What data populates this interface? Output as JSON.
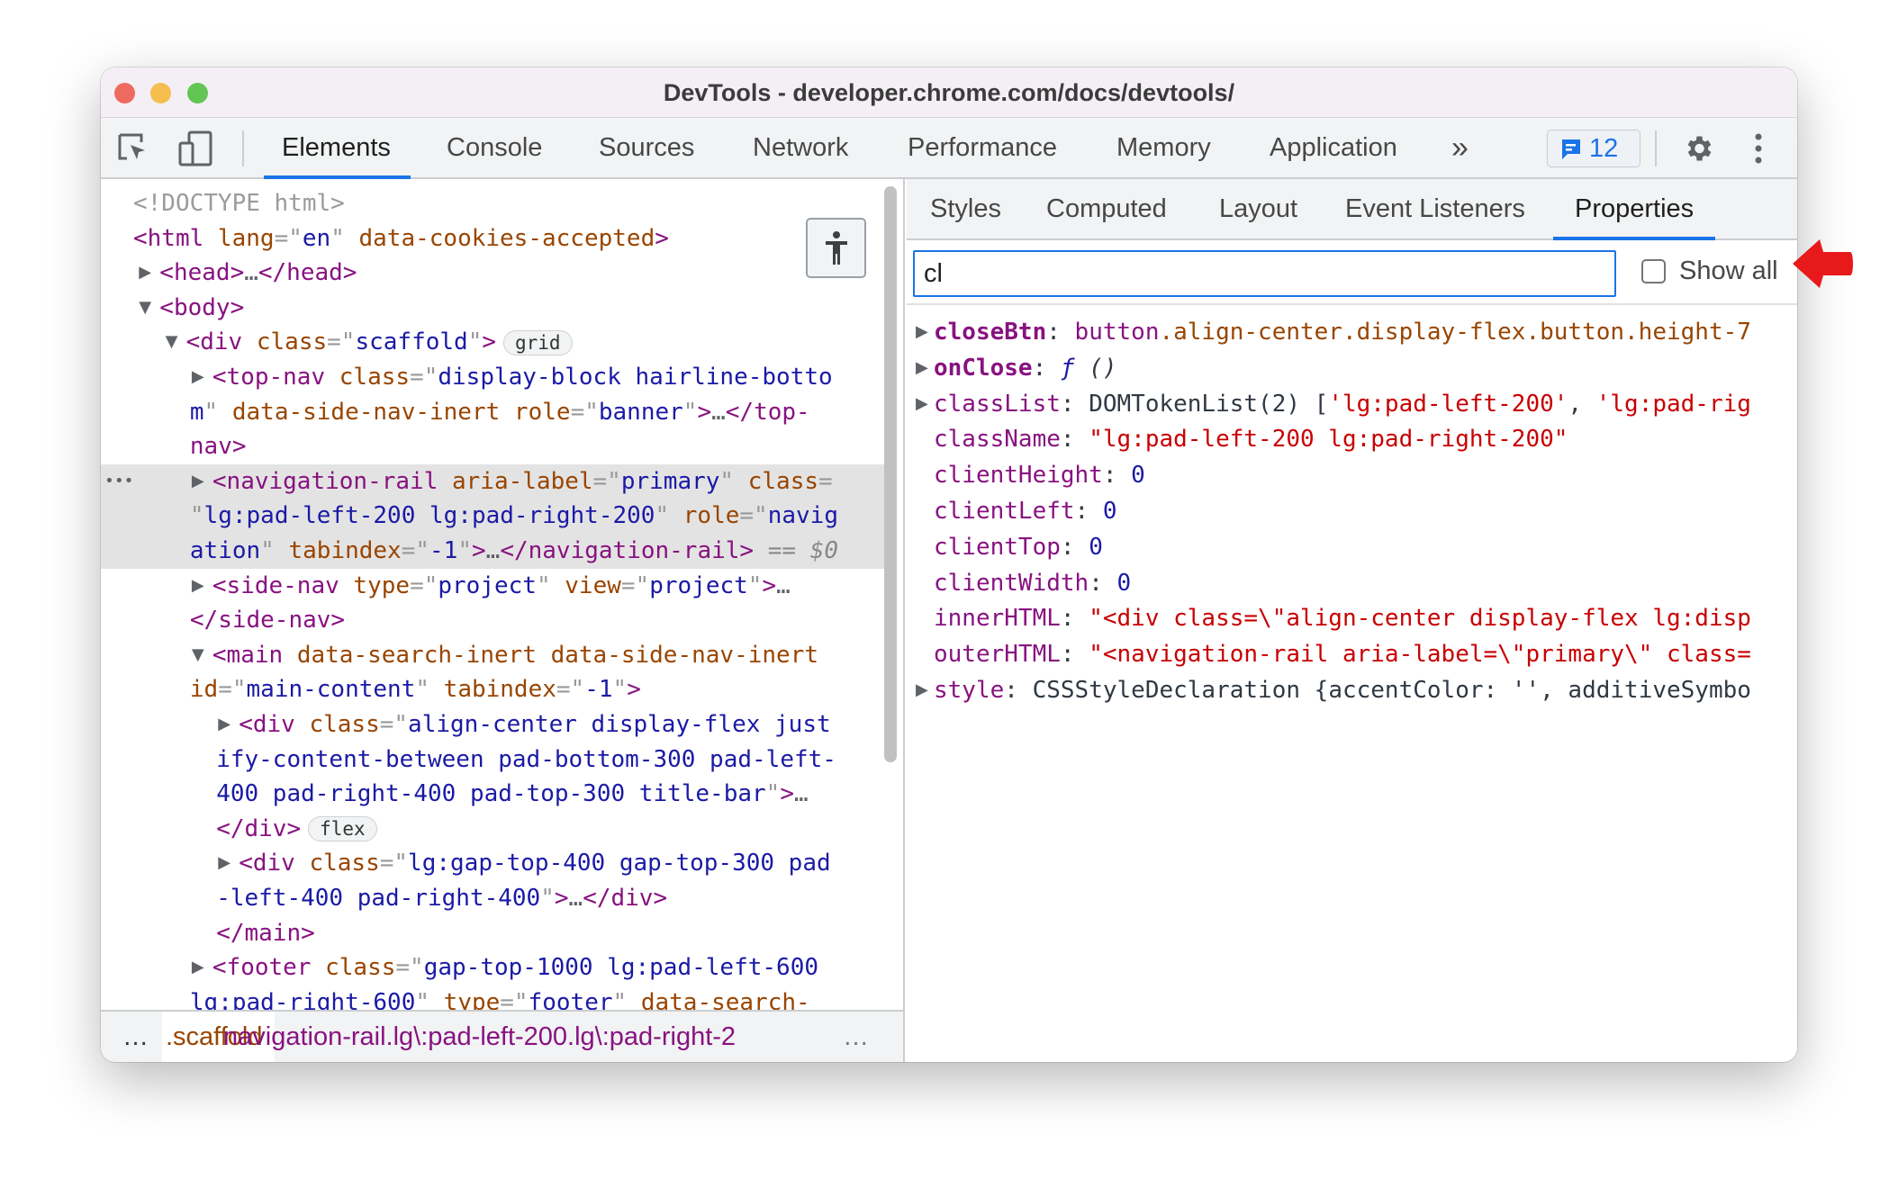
{
  "window": {
    "title": "DevTools - developer.chrome.com/docs/devtools/"
  },
  "colors": {
    "accent": "#1a73e8",
    "close": "#ee6a5f",
    "minimize": "#f5be4f",
    "zoom": "#62c554",
    "arrow": "#e8191a"
  },
  "toolbar": {
    "tabs": [
      "Elements",
      "Console",
      "Sources",
      "Network",
      "Performance",
      "Memory",
      "Application"
    ],
    "active_tab": "Elements",
    "more": "»",
    "issues_count": "12"
  },
  "elements": {
    "lines": [
      {
        "depth": 0,
        "segs": [
          [
            "c",
            "<!DOCTYPE html>"
          ]
        ]
      },
      {
        "depth": 0,
        "segs": [
          [
            "t",
            "<html"
          ],
          [
            "a",
            " lang"
          ],
          [
            "p",
            "=\""
          ],
          [
            "v",
            "en"
          ],
          [
            "p",
            "\""
          ],
          [
            "a",
            " data-cookies-accepted"
          ],
          [
            "t",
            ">"
          ]
        ]
      },
      {
        "depth": 1,
        "toggle": "right",
        "segs": [
          [
            "t",
            "<head>"
          ],
          [
            "g",
            "…"
          ],
          [
            "t",
            "</head>"
          ]
        ]
      },
      {
        "depth": 1,
        "toggle": "down",
        "segs": [
          [
            "t",
            "<body>"
          ]
        ]
      },
      {
        "depth": 2,
        "toggle": "down",
        "segs": [
          [
            "t",
            "<div"
          ],
          [
            "a",
            " class"
          ],
          [
            "p",
            "=\""
          ],
          [
            "v",
            "scaffold"
          ],
          [
            "p",
            "\""
          ],
          [
            "t",
            ">"
          ]
        ],
        "badge": "grid"
      },
      {
        "depth": 3,
        "toggle": "right",
        "segs": [
          [
            "t",
            "<top-nav"
          ],
          [
            "a",
            " class"
          ],
          [
            "p",
            "=\""
          ],
          [
            "v",
            "display-block hairline-botto"
          ]
        ]
      },
      {
        "depth": 3,
        "cont": true,
        "segs": [
          [
            "v",
            "m"
          ],
          [
            "p",
            "\""
          ],
          [
            "a",
            " data-side-nav-inert"
          ],
          [
            "a",
            " role"
          ],
          [
            "p",
            "=\""
          ],
          [
            "v",
            "banner"
          ],
          [
            "p",
            "\""
          ],
          [
            "t",
            ">"
          ],
          [
            "g",
            "…"
          ],
          [
            "t",
            "</top-"
          ]
        ]
      },
      {
        "depth": 3,
        "cont": true,
        "segs": [
          [
            "t",
            "nav>"
          ]
        ]
      },
      {
        "depth": 3,
        "toggle": "right",
        "selected": true,
        "segs": [
          [
            "t",
            "<navigation-rail"
          ],
          [
            "a",
            " aria-label"
          ],
          [
            "p",
            "=\""
          ],
          [
            "v",
            "primary"
          ],
          [
            "p",
            "\""
          ],
          [
            "a",
            " class"
          ],
          [
            "p",
            "="
          ]
        ]
      },
      {
        "depth": 3,
        "cont": true,
        "selected": true,
        "segs": [
          [
            "p",
            "\""
          ],
          [
            "v",
            "lg:pad-left-200 lg:pad-right-200"
          ],
          [
            "p",
            "\""
          ],
          [
            "a",
            " role"
          ],
          [
            "p",
            "=\""
          ],
          [
            "v",
            "navig"
          ]
        ]
      },
      {
        "depth": 3,
        "cont": true,
        "selected": true,
        "segs": [
          [
            "v",
            "ation"
          ],
          [
            "p",
            "\""
          ],
          [
            "a",
            " tabindex"
          ],
          [
            "p",
            "=\""
          ],
          [
            "v",
            "-1"
          ],
          [
            "p",
            "\""
          ],
          [
            "t",
            ">"
          ],
          [
            "g",
            "…"
          ],
          [
            "t",
            "</navigation-rail>"
          ],
          [
            "gi",
            " == "
          ],
          [
            "gi",
            "$0"
          ]
        ]
      },
      {
        "depth": 3,
        "toggle": "right",
        "segs": [
          [
            "t",
            "<side-nav"
          ],
          [
            "a",
            " type"
          ],
          [
            "p",
            "=\""
          ],
          [
            "v",
            "project"
          ],
          [
            "p",
            "\""
          ],
          [
            "a",
            " view"
          ],
          [
            "p",
            "=\""
          ],
          [
            "v",
            "project"
          ],
          [
            "p",
            "\""
          ],
          [
            "t",
            ">"
          ],
          [
            "g",
            "…"
          ]
        ]
      },
      {
        "depth": 3,
        "cont": true,
        "segs": [
          [
            "t",
            "</side-nav>"
          ]
        ]
      },
      {
        "depth": 3,
        "toggle": "down",
        "segs": [
          [
            "t",
            "<main"
          ],
          [
            "a",
            " data-search-inert data-side-nav-inert"
          ]
        ]
      },
      {
        "depth": 3,
        "cont": true,
        "segs": [
          [
            "a",
            "id"
          ],
          [
            "p",
            "=\""
          ],
          [
            "v",
            "main-content"
          ],
          [
            "p",
            "\""
          ],
          [
            "a",
            " tabindex"
          ],
          [
            "p",
            "=\""
          ],
          [
            "v",
            "-1"
          ],
          [
            "p",
            "\""
          ],
          [
            "t",
            ">"
          ]
        ]
      },
      {
        "depth": 4,
        "toggle": "right",
        "segs": [
          [
            "t",
            "<div"
          ],
          [
            "a",
            " class"
          ],
          [
            "p",
            "=\""
          ],
          [
            "v",
            "align-center display-flex just"
          ]
        ]
      },
      {
        "depth": 4,
        "cont": true,
        "segs": [
          [
            "v",
            "ify-content-between pad-bottom-300 pad-left-"
          ]
        ]
      },
      {
        "depth": 4,
        "cont": true,
        "segs": [
          [
            "v",
            "400 pad-right-400 pad-top-300 title-bar"
          ],
          [
            "p",
            "\""
          ],
          [
            "t",
            ">"
          ],
          [
            "g",
            "…"
          ]
        ]
      },
      {
        "depth": 4,
        "cont": true,
        "segs": [
          [
            "t",
            "</div>"
          ]
        ],
        "badge": "flex"
      },
      {
        "depth": 4,
        "toggle": "right",
        "segs": [
          [
            "t",
            "<div"
          ],
          [
            "a",
            " class"
          ],
          [
            "p",
            "=\""
          ],
          [
            "v",
            "lg:gap-top-400 gap-top-300 pad"
          ]
        ]
      },
      {
        "depth": 4,
        "cont": true,
        "segs": [
          [
            "v",
            "-left-400 pad-right-400"
          ],
          [
            "p",
            "\""
          ],
          [
            "t",
            ">"
          ],
          [
            "g",
            "…"
          ],
          [
            "t",
            "</div>"
          ]
        ]
      },
      {
        "depth": 4,
        "cont": true,
        "segs": [
          [
            "t",
            "</main>"
          ]
        ]
      },
      {
        "depth": 3,
        "toggle": "right",
        "segs": [
          [
            "t",
            "<footer"
          ],
          [
            "a",
            " class"
          ],
          [
            "p",
            "=\""
          ],
          [
            "v",
            "gap-top-1000 lg:pad-left-600"
          ]
        ]
      },
      {
        "depth": 3,
        "cont": true,
        "segs": [
          [
            "v",
            "lg:pad-right-600"
          ],
          [
            "p",
            "\""
          ],
          [
            "a",
            " type"
          ],
          [
            "p",
            "=\""
          ],
          [
            "v",
            "footer"
          ],
          [
            "p",
            "\""
          ],
          [
            "a",
            " data-search-"
          ]
        ]
      }
    ],
    "selected_marker": "•••"
  },
  "breadcrumbs": {
    "more_left": "…",
    "items": [
      ".scaffold",
      "navigation-rail.lg\\:pad-left-200.lg\\:pad-right-2"
    ],
    "more_right": "…"
  },
  "sidebar": {
    "tabs": [
      "Styles",
      "Computed",
      "Layout",
      "Event Listeners",
      "Properties"
    ],
    "active_tab": "Properties",
    "more": "»",
    "filter_value": "cl",
    "show_all_label": "Show all",
    "show_all_checked": false,
    "properties": [
      {
        "toggle": true,
        "segs": [
          [
            "kb",
            "closeBtn"
          ],
          [
            "o",
            ": "
          ],
          [
            "k",
            "button"
          ],
          [
            "a",
            ".align-center.display-flex.button.height-7"
          ]
        ]
      },
      {
        "toggle": true,
        "segs": [
          [
            "kb",
            "onClose"
          ],
          [
            "o",
            ": "
          ],
          [
            "fn",
            "ƒ"
          ],
          [
            "fi",
            " ()"
          ]
        ]
      },
      {
        "toggle": true,
        "segs": [
          [
            "k",
            "classList"
          ],
          [
            "o",
            ": "
          ],
          [
            "o",
            "DOMTokenList(2) ["
          ],
          [
            "s",
            "'lg:pad-left-200'"
          ],
          [
            "o",
            ", "
          ],
          [
            "s",
            "'lg:pad-rig"
          ]
        ]
      },
      {
        "segs": [
          [
            "k",
            "className"
          ],
          [
            "o",
            ": "
          ],
          [
            "s",
            "\"lg:pad-left-200 lg:pad-right-200\""
          ]
        ]
      },
      {
        "segs": [
          [
            "k",
            "clientHeight"
          ],
          [
            "o",
            ": "
          ],
          [
            "n",
            "0"
          ]
        ]
      },
      {
        "segs": [
          [
            "k",
            "clientLeft"
          ],
          [
            "o",
            ": "
          ],
          [
            "n",
            "0"
          ]
        ]
      },
      {
        "segs": [
          [
            "k",
            "clientTop"
          ],
          [
            "o",
            ": "
          ],
          [
            "n",
            "0"
          ]
        ]
      },
      {
        "segs": [
          [
            "k",
            "clientWidth"
          ],
          [
            "o",
            ": "
          ],
          [
            "n",
            "0"
          ]
        ]
      },
      {
        "segs": [
          [
            "k",
            "innerHTML"
          ],
          [
            "o",
            ": "
          ],
          [
            "s",
            "\"<div class=\\\"align-center display-flex lg:disp"
          ]
        ]
      },
      {
        "segs": [
          [
            "k",
            "outerHTML"
          ],
          [
            "o",
            ": "
          ],
          [
            "s",
            "\"<navigation-rail aria-label=\\\"primary\\\" class="
          ]
        ]
      },
      {
        "toggle": true,
        "segs": [
          [
            "k",
            "style"
          ],
          [
            "o",
            ": "
          ],
          [
            "o",
            "CSSStyleDeclaration {accentColor: "
          ],
          [
            "o",
            "''"
          ],
          [
            "o",
            ", additiveSymbo"
          ]
        ]
      }
    ]
  }
}
